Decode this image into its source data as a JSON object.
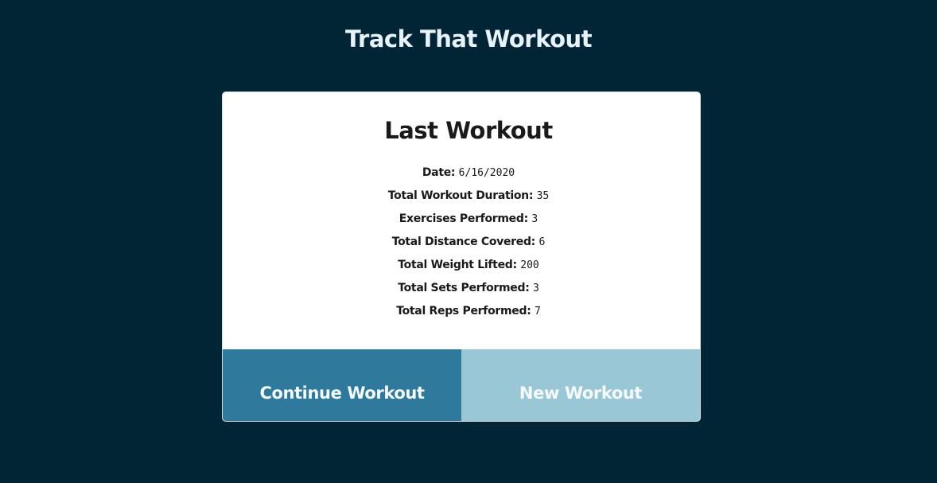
{
  "header": {
    "title": "Track That Workout"
  },
  "card": {
    "title": "Last Workout",
    "stats": [
      {
        "label": "Date:",
        "value": "6/16/2020"
      },
      {
        "label": "Total Workout Duration:",
        "value": "35"
      },
      {
        "label": "Exercises Performed:",
        "value": "3"
      },
      {
        "label": "Total Distance Covered:",
        "value": "6"
      },
      {
        "label": "Total Weight Lifted:",
        "value": "200"
      },
      {
        "label": "Total Sets Performed:",
        "value": "3"
      },
      {
        "label": "Total Reps Performed:",
        "value": "7"
      }
    ],
    "buttons": {
      "continue_label": "Continue Workout",
      "new_label": "New Workout"
    }
  },
  "colors": {
    "background": "#012535",
    "card": "#ffffff",
    "continue_button": "#2f7a9c",
    "new_button": "#99c7d6"
  }
}
